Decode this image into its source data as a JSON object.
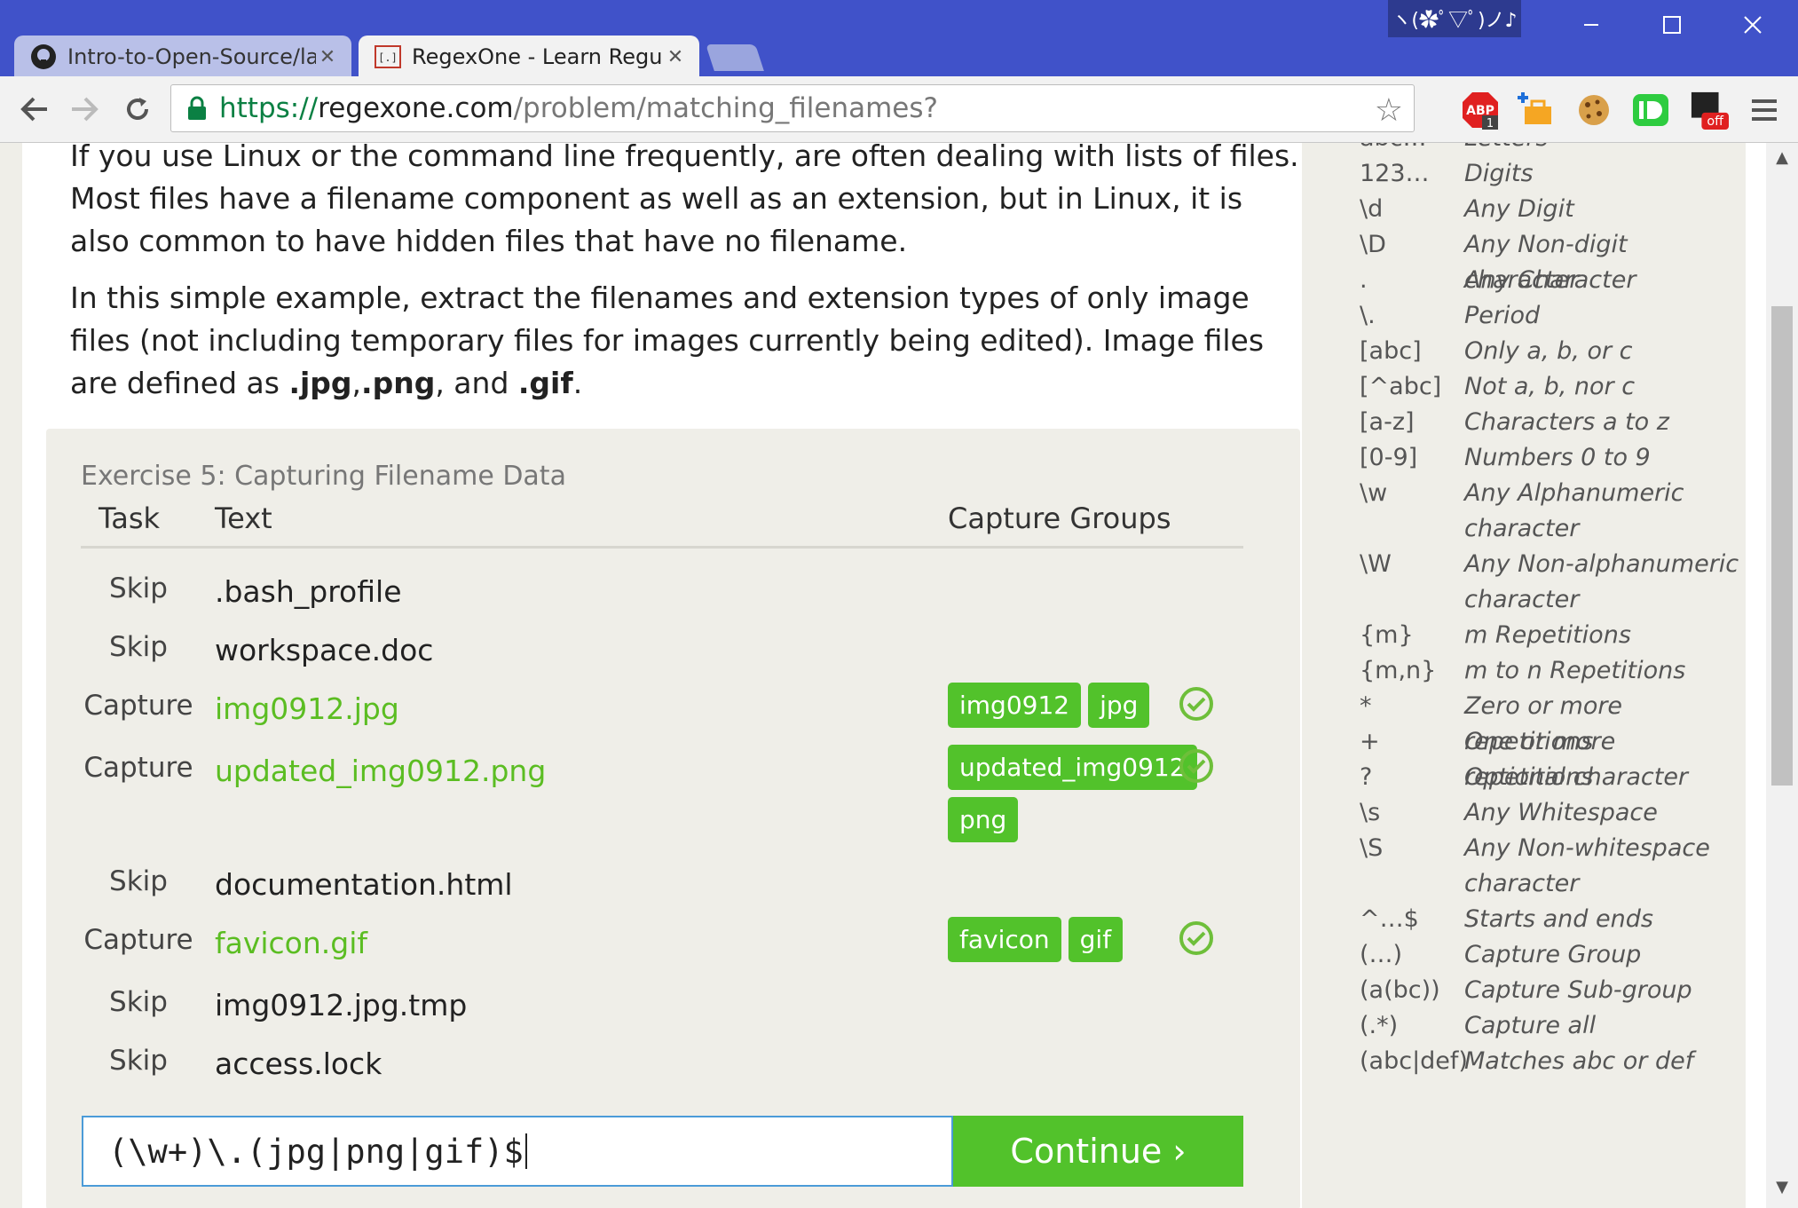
{
  "browser": {
    "tabs": [
      {
        "title": "Intro-to-Open-Source/lab",
        "active": false
      },
      {
        "title": "RegexOne - Learn Regular",
        "active": true
      }
    ],
    "emoticon": "ヽ(✿ﾟ▽ﾟ)ノ♪",
    "url": {
      "scheme": "https://",
      "host": "regexone.com",
      "path": "/problem/matching_filenames?"
    },
    "extensions": {
      "abp_label": "ABP",
      "abp_count": "1",
      "off_label": "off"
    }
  },
  "lesson": {
    "para1": "If you use Linux or the command line frequently, are often dealing with lists of files. Most files have a filename component as well as an extension, but in Linux, it is also common to have hidden files that have no filename.",
    "para2_prefix": "In this simple example, extract the filenames and extension types of only image files (not including temporary files for images currently being edited). Image files are defined as ",
    "para2_jpg": ".jpg",
    "para2_comma": ",",
    "para2_png": ".png",
    "para2_and": ", and ",
    "para2_gif": ".gif",
    "para2_end": "."
  },
  "exercise": {
    "title": "Exercise 5: Capturing Filename Data",
    "headers": {
      "task": "Task",
      "text": "Text",
      "groups": "Capture Groups"
    },
    "rows": [
      {
        "task": "Skip",
        "text": ".bash_profile",
        "groups": []
      },
      {
        "task": "Skip",
        "text": "workspace.doc",
        "groups": []
      },
      {
        "task": "Capture",
        "text": "img0912.jpg",
        "groups": [
          "img0912",
          "jpg"
        ]
      },
      {
        "task": "Capture",
        "text": "updated_img0912.png",
        "groups": [
          "updated_img0912",
          "png"
        ]
      },
      {
        "task": "Skip",
        "text": "documentation.html",
        "groups": []
      },
      {
        "task": "Capture",
        "text": "favicon.gif",
        "groups": [
          "favicon",
          "gif"
        ]
      },
      {
        "task": "Skip",
        "text": "img0912.jpg.tmp",
        "groups": []
      },
      {
        "task": "Skip",
        "text": "access.lock",
        "groups": []
      }
    ],
    "input_value": "(\\w+)\\.(jpg|png|gif)$",
    "continue_label": "Continue ›"
  },
  "reference": [
    {
      "sym": "abc…",
      "desc": "Letters"
    },
    {
      "sym": "123…",
      "desc": "Digits"
    },
    {
      "sym": "\\d",
      "desc": "Any Digit"
    },
    {
      "sym": "\\D",
      "desc": "Any Non-digit character"
    },
    {
      "sym": ".",
      "desc": "Any Character"
    },
    {
      "sym": "\\.",
      "desc": "Period"
    },
    {
      "sym": "[abc]",
      "desc": "Only a, b, or c"
    },
    {
      "sym": "[^abc]",
      "desc": "Not a, b, nor c"
    },
    {
      "sym": "[a-z]",
      "desc": "Characters a to z"
    },
    {
      "sym": "[0-9]",
      "desc": "Numbers 0 to 9"
    },
    {
      "sym": "\\w",
      "desc": "Any Alphanumeric character"
    },
    {
      "sym": "\\W",
      "desc": "Any Non-alphanumeric character"
    },
    {
      "sym": "{m}",
      "desc": "m Repetitions"
    },
    {
      "sym": "{m,n}",
      "desc": "m to n Repetitions"
    },
    {
      "sym": "*",
      "desc": "Zero or more repetitions"
    },
    {
      "sym": "+",
      "desc": "One or more repetitions"
    },
    {
      "sym": "?",
      "desc": "Optional character"
    },
    {
      "sym": "\\s",
      "desc": "Any Whitespace"
    },
    {
      "sym": "\\S",
      "desc": "Any Non-whitespace character"
    },
    {
      "sym": "^…$",
      "desc": "Starts and ends"
    },
    {
      "sym": "(…)",
      "desc": "Capture Group"
    },
    {
      "sym": "(a(bc))",
      "desc": "Capture Sub-group"
    },
    {
      "sym": "(.*)",
      "desc": "Capture all"
    },
    {
      "sym": "(abc|def)",
      "desc": "Matches abc or def"
    }
  ],
  "colors": {
    "accent_green": "#52c22b",
    "chrome_blue": "#4052c9"
  },
  "icons": {
    "back": "back-arrow-icon",
    "forward": "forward-arrow-icon",
    "reload": "reload-icon",
    "lock": "lock-icon",
    "star": "star-icon",
    "check": "check-circle-icon",
    "menu": "hamburger-menu-icon"
  }
}
